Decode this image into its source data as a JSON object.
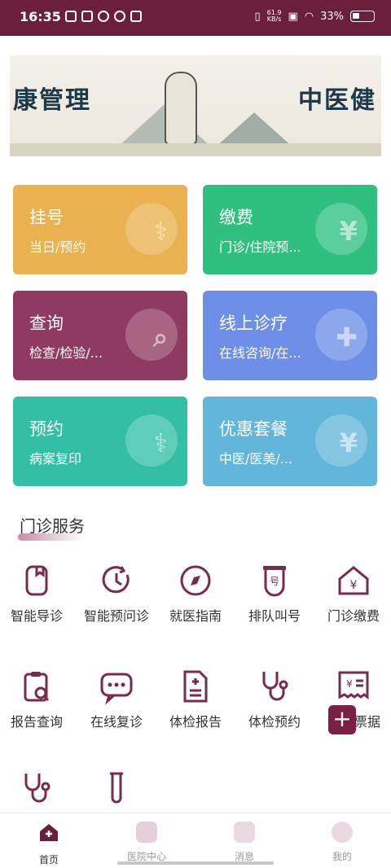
{
  "status_bar": {
    "time": "16:35",
    "speed": "61.9",
    "speed_unit": "KB/s",
    "battery": "33%",
    "icons": [
      "music-app-icon",
      "gallery-app-icon",
      "qq-icon",
      "wechat-icon",
      "mail-icon",
      "vibrate-icon",
      "sim-icon",
      "wifi-icon",
      "battery-icon"
    ]
  },
  "banner": {
    "left_text": "康管理",
    "right_text": "中医健"
  },
  "cards": [
    {
      "title": "挂号",
      "subtitle": "当日/预约",
      "color": "#e9b14f",
      "icon": "stethoscope-icon",
      "glyph": "⚕"
    },
    {
      "title": "缴费",
      "subtitle": "门诊/住院预...",
      "color": "#2fc07f",
      "icon": "yuan-house-icon",
      "glyph": "¥"
    },
    {
      "title": "查询",
      "subtitle": "检查/检验/...",
      "color": "#8f3a60",
      "icon": "clipboard-search-icon",
      "glyph": "⌕"
    },
    {
      "title": "线上诊疗",
      "subtitle": "在线咨询/在...",
      "color": "#6e8fe8",
      "icon": "heart-hand-icon",
      "glyph": "✚"
    },
    {
      "title": "预约",
      "subtitle": "病案复印",
      "color": "#33bfa6",
      "icon": "stethoscope-icon",
      "glyph": "⚕"
    },
    {
      "title": "优惠套餐",
      "subtitle": "中医/医美/...",
      "color": "#62b6da",
      "icon": "yuan-box-icon",
      "glyph": "¥"
    }
  ],
  "section": {
    "title": "门诊服务"
  },
  "services": [
    {
      "label": "智能导诊",
      "icon": "guide-icon"
    },
    {
      "label": "智能预问诊",
      "icon": "clock-icon"
    },
    {
      "label": "就医指南",
      "icon": "compass-icon"
    },
    {
      "label": "排队叫号",
      "icon": "queue-number-icon"
    },
    {
      "label": "门诊缴费",
      "icon": "yuan-house-icon"
    },
    {
      "label": "报告查询",
      "icon": "report-search-icon"
    },
    {
      "label": "在线复诊",
      "icon": "chat-icon"
    },
    {
      "label": "体检报告",
      "icon": "document-plus-icon"
    },
    {
      "label": "体检预约",
      "icon": "stethoscope-icon"
    },
    {
      "label": "票据",
      "icon": "receipt-icon"
    },
    {
      "label": "",
      "icon": "stethoscope-icon"
    },
    {
      "label": "",
      "icon": "test-tube-icon"
    }
  ],
  "tabbar": [
    {
      "label": "首页",
      "icon": "home-icon",
      "active": true
    },
    {
      "label": "医院中心",
      "icon": "hospital-icon",
      "active": false
    },
    {
      "label": "消息",
      "icon": "message-icon",
      "active": false
    },
    {
      "label": "我的",
      "icon": "profile-icon",
      "active": false
    }
  ],
  "colors": {
    "brand": "#6b1f3c",
    "accent": "#7a1f45",
    "tab_active": "#6b1f3c",
    "tab_inactive": "#9a9a9a"
  }
}
